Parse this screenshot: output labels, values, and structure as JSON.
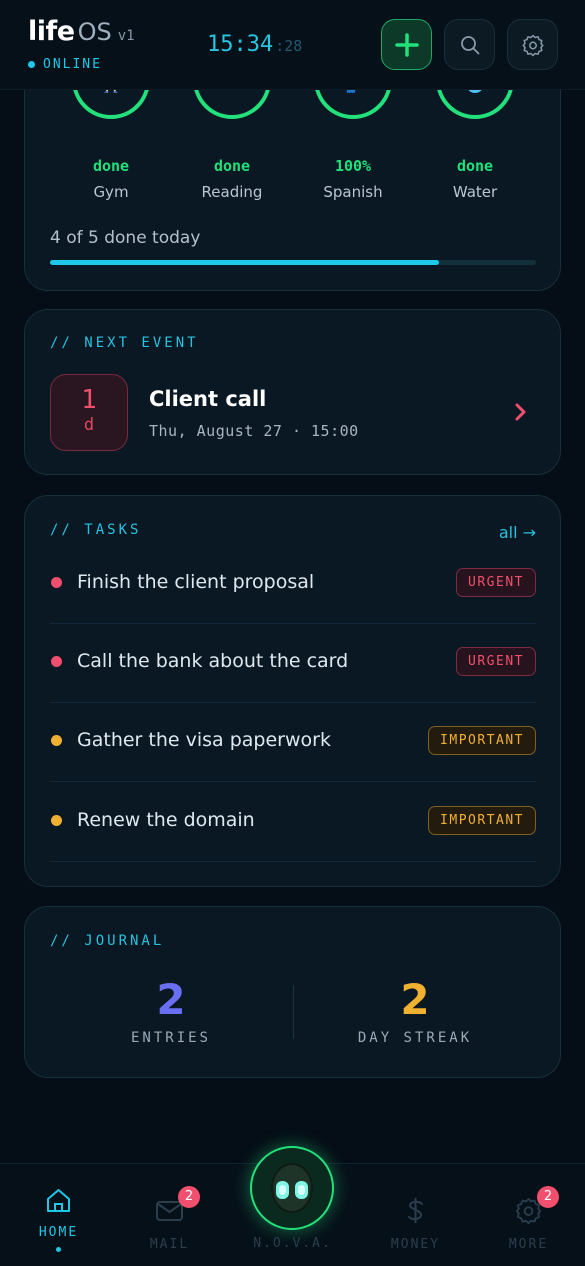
{
  "header": {
    "brand_life": "life",
    "brand_os": "OS",
    "version": "v1",
    "status": "ONLINE",
    "clock_hm": "15:34",
    "clock_s": ":28",
    "add_icon": "plus-icon",
    "search_icon": "search-icon",
    "settings_icon": "gear-icon"
  },
  "habits": {
    "items": [
      {
        "emoji": "🏋️",
        "state": "done",
        "name": "Gym"
      },
      {
        "emoji": "📖",
        "state": "done",
        "name": "Reading"
      },
      {
        "emoji": "🗣️",
        "state": "100%",
        "name": "Spanish"
      },
      {
        "emoji": "💧",
        "state": "done",
        "name": "Water"
      }
    ],
    "summary": "4 of 5 done today",
    "progress": 0.8
  },
  "next_event": {
    "label": "// NEXT EVENT",
    "days_num": "1",
    "days_unit": "d",
    "title": "Client call",
    "time": "Thu, August 27 · 15:00"
  },
  "tasks": {
    "label": "// TASKS",
    "all_link": "all →",
    "items": [
      {
        "text": "Finish the client proposal",
        "tag": "URGENT"
      },
      {
        "text": "Call the bank about the card",
        "tag": "URGENT"
      },
      {
        "text": "Gather the visa paperwork",
        "tag": "IMPORTANT"
      },
      {
        "text": "Renew the domain",
        "tag": "IMPORTANT"
      }
    ]
  },
  "journal": {
    "label": "// JOURNAL",
    "entries_value": "2",
    "entries_label": "ENTRIES",
    "streak_value": "2",
    "streak_label": "DAY STREAK"
  },
  "nav": {
    "home": "HOME",
    "mail": "MAIL",
    "mail_badge": "2",
    "nova": "N.O.V.A.",
    "money": "MONEY",
    "more": "MORE",
    "more_badge": "2"
  },
  "colors": {
    "accent": "#1ec8e8",
    "green": "#22e07a",
    "urgent": "#f0506e",
    "important": "#f0b030",
    "entries": "#6a6ef0"
  }
}
